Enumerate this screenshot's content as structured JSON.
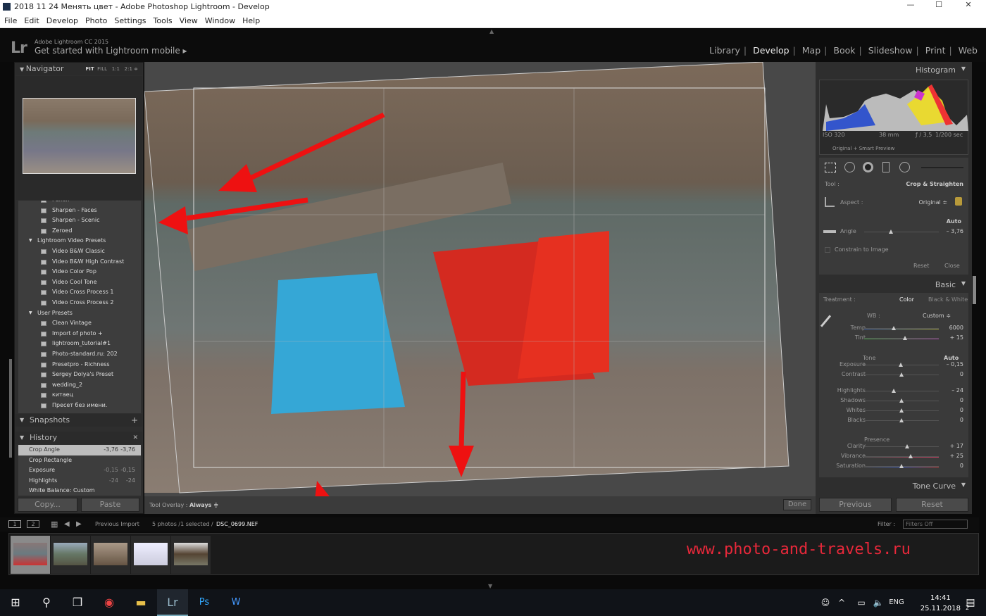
{
  "window": {
    "title": "2018 11 24 Менять цвет - Adobe Photoshop Lightroom - Develop",
    "min": "—",
    "max": "☐",
    "close": "✕"
  },
  "menu": [
    "File",
    "Edit",
    "Develop",
    "Photo",
    "Settings",
    "Tools",
    "View",
    "Window",
    "Help"
  ],
  "header": {
    "logo": "Lr",
    "product": "Adobe Lightroom CC 2015",
    "mobile": "Get started with Lightroom mobile ▸",
    "modules": [
      "Library",
      "Develop",
      "Map",
      "Book",
      "Slideshow",
      "Print",
      "Web"
    ],
    "active_module": "Develop"
  },
  "navigator": {
    "title": "Navigator",
    "zoom": [
      "FIT",
      "FILL",
      "1:1",
      "2:1 ≑"
    ]
  },
  "presets": [
    {
      "type": "item",
      "label": "Punch"
    },
    {
      "type": "item",
      "label": "Sharpen - Faces"
    },
    {
      "type": "item",
      "label": "Sharpen - Scenic"
    },
    {
      "type": "item",
      "label": "Zeroed"
    },
    {
      "type": "group",
      "label": "Lightroom Video Presets"
    },
    {
      "type": "item",
      "label": "Video B&W Classic"
    },
    {
      "type": "item",
      "label": "Video B&W High Contrast"
    },
    {
      "type": "item",
      "label": "Video Color Pop"
    },
    {
      "type": "item",
      "label": "Video Cool Tone"
    },
    {
      "type": "item",
      "label": "Video Cross Process 1"
    },
    {
      "type": "item",
      "label": "Video Cross Process 2"
    },
    {
      "type": "group",
      "label": "User Presets"
    },
    {
      "type": "item",
      "label": "Clean Vintage"
    },
    {
      "type": "item",
      "label": "Import of photo  +"
    },
    {
      "type": "item",
      "label": "lightroom_tutorial#1"
    },
    {
      "type": "item",
      "label": "Photo-standard.ru: 202"
    },
    {
      "type": "item",
      "label": "Presetpro - Richness"
    },
    {
      "type": "item",
      "label": "Sergey Dolya's Preset"
    },
    {
      "type": "item",
      "label": "wedding_2"
    },
    {
      "type": "item",
      "label": "китаец"
    },
    {
      "type": "item",
      "label": "Пресет без имени."
    }
  ],
  "snapshots": {
    "title": "Snapshots",
    "action": "+"
  },
  "history": {
    "title": "History",
    "action": "✕",
    "items": [
      {
        "label": "Crop Angle",
        "from": "-3,76",
        "to": "-3,76",
        "selected": true
      },
      {
        "label": "Crop Rectangle",
        "from": "",
        "to": ""
      },
      {
        "label": "Exposure",
        "from": "-0,15",
        "to": "-0,15"
      },
      {
        "label": "Highlights",
        "from": "-24",
        "to": "-24"
      },
      {
        "label": "White Balance: Custom",
        "from": "",
        "to": ""
      }
    ]
  },
  "left_buttons": {
    "copy": "Copy...",
    "paste": "Paste"
  },
  "toolbar": {
    "overlay_label": "Tool Overlay :",
    "overlay_value": "Always ≑",
    "done": "Done"
  },
  "histogram": {
    "title": "Histogram",
    "iso": "ISO 320",
    "focal": "38 mm",
    "aperture": "ƒ / 3,5",
    "shutter": "1/200 sec",
    "preview": "Original + Smart Preview"
  },
  "crop": {
    "tool_label": "Tool :",
    "tool_value": "Crop & Straighten",
    "aspect_label": "Aspect :",
    "aspect_value": "Original ≑",
    "auto": "Auto",
    "angle_label": "Angle",
    "angle_value": "– 3,76",
    "angle_fraction": 0.36,
    "constrain": "Constrain to Image",
    "reset": "Reset",
    "close": "Close"
  },
  "basic": {
    "title": "Basic",
    "treatment_label": "Treatment :",
    "color": "Color",
    "bw": "Black & White",
    "wb_label": "WB :",
    "wb_value": "Custom ≑",
    "tone_label": "Tone",
    "auto": "Auto",
    "presence_label": "Presence",
    "sliders": [
      {
        "label": "Temp",
        "value": "6000",
        "pos": 0.4
      },
      {
        "label": "Tint",
        "value": "+ 15",
        "pos": 0.55
      },
      {
        "label": "Exposure",
        "value": "– 0,15",
        "pos": 0.49
      },
      {
        "label": "Contrast",
        "value": "0",
        "pos": 0.5
      },
      {
        "label": "Highlights",
        "value": "– 24",
        "pos": 0.4
      },
      {
        "label": "Shadows",
        "value": "0",
        "pos": 0.5
      },
      {
        "label": "Whites",
        "value": "0",
        "pos": 0.5
      },
      {
        "label": "Blacks",
        "value": "0",
        "pos": 0.5
      },
      {
        "label": "Clarity",
        "value": "+ 17",
        "pos": 0.58
      },
      {
        "label": "Vibrance",
        "value": "+ 25",
        "pos": 0.62
      },
      {
        "label": "Saturation",
        "value": "0",
        "pos": 0.5
      }
    ]
  },
  "tone_curve": {
    "title": "Tone Curve"
  },
  "right_buttons": {
    "previous": "Previous",
    "reset": "Reset"
  },
  "filmstrip": {
    "view1": "1",
    "view2": "2",
    "source": "Previous Import",
    "count": "5 photos /1 selected /",
    "file": "DSC_0699.NEF",
    "filter_label": "Filter :",
    "filter_value": "Filters Off"
  },
  "watermark": "www.photo-and-travels.ru",
  "taskbar": {
    "lang": "ENG",
    "time": "14:41",
    "date": "25.11.2018",
    "notifications": "2"
  },
  "colors": {
    "arrow": "#ee1111",
    "watermark": "#e8283a",
    "panel": "#3a3a3a"
  }
}
